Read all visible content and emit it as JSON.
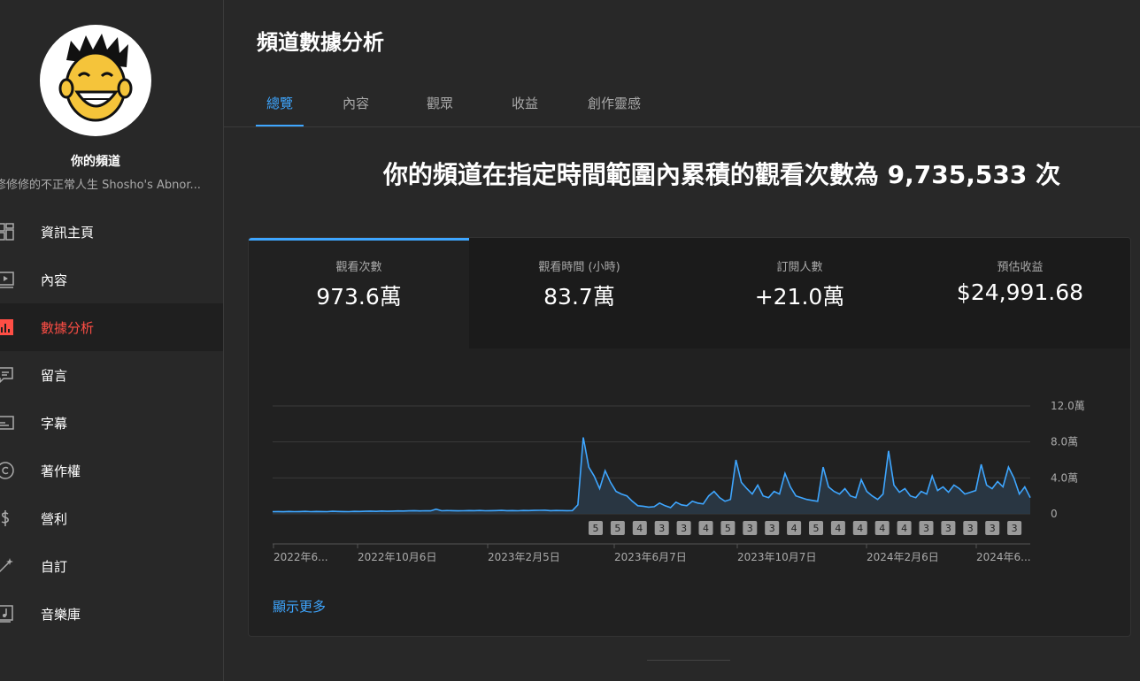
{
  "sidebar": {
    "channel_title": "你的頻道",
    "channel_subtitle": "修修修的不正常人生 Shosho's Abnor...",
    "items": [
      {
        "label": "資訊主頁",
        "icon": "dashboard-icon"
      },
      {
        "label": "內容",
        "icon": "content-icon"
      },
      {
        "label": "數據分析",
        "icon": "analytics-icon",
        "active": true
      },
      {
        "label": "留言",
        "icon": "comments-icon"
      },
      {
        "label": "字幕",
        "icon": "subtitles-icon"
      },
      {
        "label": "著作權",
        "icon": "copyright-icon"
      },
      {
        "label": "營利",
        "icon": "monetization-icon"
      },
      {
        "label": "自訂",
        "icon": "customization-icon"
      },
      {
        "label": "音樂庫",
        "icon": "audio-library-icon"
      }
    ]
  },
  "main": {
    "title": "頻道數據分析",
    "tabs": [
      {
        "label": "總覽",
        "active": true
      },
      {
        "label": "內容"
      },
      {
        "label": "觀眾"
      },
      {
        "label": "收益"
      },
      {
        "label": "創作靈感"
      }
    ],
    "headline_prefix": "你的頻道在指定時間範圍內累積的觀看次數為 ",
    "headline_number": "9,735,533",
    "headline_suffix": " 次",
    "metrics": [
      {
        "label": "觀看次數",
        "value": "973.6萬",
        "active": true
      },
      {
        "label": "觀看時間 (小時)",
        "value": "83.7萬"
      },
      {
        "label": "訂閱人數",
        "value": "+21.0萬"
      },
      {
        "label": "預估收益",
        "value": "$24,991.68"
      }
    ],
    "show_more": "顯示更多"
  },
  "colors": {
    "accent": "#3ea6ff",
    "active_nav": "#ff4e45",
    "line": "#3ea6ff"
  },
  "chart_data": {
    "type": "area",
    "x_tick_labels": [
      "2022年6...",
      "2022年10月6日",
      "2023年2月5日",
      "2023年6月7日",
      "2023年10月7日",
      "2024年2月6日",
      "2024年6..."
    ],
    "y_tick_labels": [
      "0",
      "4.0萬",
      "8.0萬",
      "12.0萬"
    ],
    "ylim": [
      0,
      120000
    ],
    "y_axis_side": "right",
    "grid": true,
    "series": [
      {
        "values": [
          2500,
          2600,
          2400,
          2700,
          2500,
          2600,
          2800,
          2500,
          2700,
          2600,
          2500,
          2900,
          2700,
          2600,
          2500,
          2800,
          2700,
          2900,
          3000,
          2800,
          3100,
          2900,
          3000,
          3200,
          3100,
          3300,
          3500,
          3200,
          3400,
          3300,
          5200,
          3400,
          3600,
          3500,
          3300,
          3400,
          3600,
          3500,
          3700,
          3400,
          3500,
          3600,
          3800,
          3500,
          3600,
          3400,
          3700,
          3600,
          3800,
          3900,
          4000,
          3500,
          3700,
          3600,
          3500,
          3600,
          10000,
          85000,
          52000,
          42000,
          28000,
          48000,
          35000,
          25000,
          22000,
          20000,
          14000,
          9000,
          8500,
          7500,
          8000,
          12000,
          9000,
          7000,
          13000,
          10000,
          9000,
          14000,
          12000,
          11000,
          20000,
          25000,
          18000,
          14000,
          16000,
          60000,
          35000,
          28000,
          22000,
          32000,
          20000,
          18000,
          25000,
          22000,
          45000,
          30000,
          20000,
          18000,
          16000,
          15000,
          14000,
          52000,
          30000,
          25000,
          22000,
          28000,
          20000,
          18000,
          38000,
          25000,
          20000,
          16000,
          22000,
          70000,
          32000,
          24000,
          28000,
          20000,
          18000,
          25000,
          22000,
          42000,
          26000,
          30000,
          24000,
          32000,
          28000,
          22000,
          24000,
          26000,
          55000,
          32000,
          28000,
          36000,
          30000,
          52000,
          40000,
          22000,
          30000,
          18000
        ]
      }
    ],
    "markers": [
      "5",
      "5",
      "4",
      "3",
      "3",
      "4",
      "5",
      "3",
      "3",
      "4",
      "5",
      "4",
      "4",
      "4",
      "4",
      "3",
      "3",
      "3",
      "3",
      "3"
    ]
  }
}
